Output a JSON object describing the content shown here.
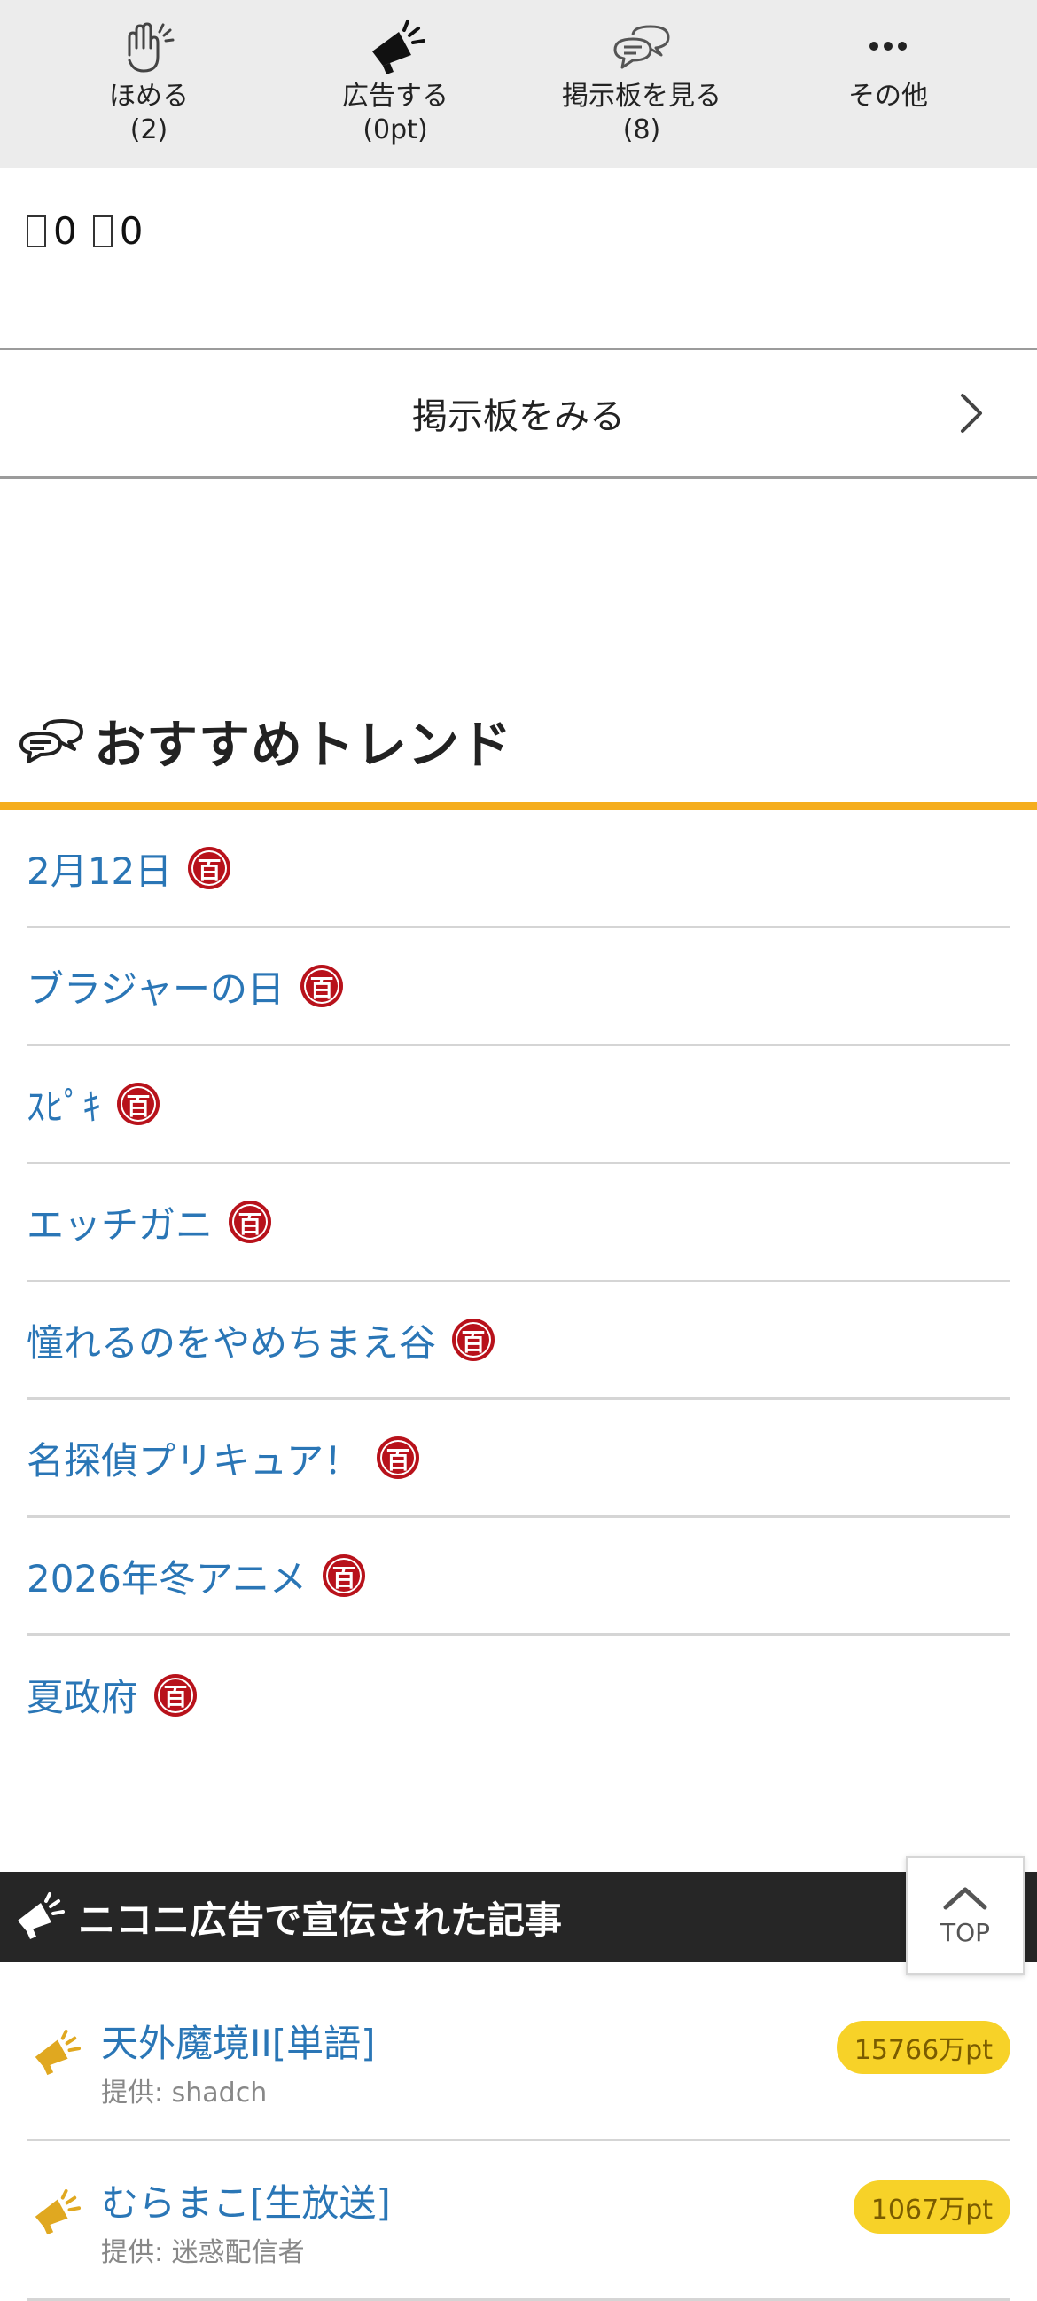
{
  "action_bar": {
    "items": [
      {
        "label": "ほめる",
        "count": "(2)",
        "icon": "clapping-hands-icon"
      },
      {
        "label": "広告する",
        "count": "(0pt)",
        "icon": "megaphone-icon"
      },
      {
        "label": "掲示板を見る",
        "count": "(8)",
        "icon": "speech-bubbles-icon"
      },
      {
        "label": "その他",
        "count": "",
        "icon": "more-dots-icon"
      }
    ]
  },
  "reactions": {
    "first_value": "0",
    "second_value": "0"
  },
  "board_link": {
    "label": "掲示板をみる",
    "icon": "chevron-right-icon"
  },
  "trends": {
    "title": "おすすめトレンド",
    "icon": "speech-bubbles-icon",
    "badge_text": "百",
    "items": [
      {
        "label": "2月12日"
      },
      {
        "label": "ブラジャーの日"
      },
      {
        "label": "ｽﾋﾟｷ"
      },
      {
        "label": "エッチガニ"
      },
      {
        "label": "憧れるのをやめちまえ谷"
      },
      {
        "label": "名探偵プリキュア！"
      },
      {
        "label": "2026年冬アニメ"
      },
      {
        "label": "夏政府"
      }
    ]
  },
  "ads": {
    "title": "ニコニ広告で宣伝された記事",
    "icon": "megaphone-icon",
    "items": [
      {
        "name": "天外魔境II[単語]",
        "provider": "提供: shadch",
        "points": "15766万pt"
      },
      {
        "name": "むらまこ[生放送]",
        "provider": "提供: 迷惑配信者",
        "points": "1067万pt"
      }
    ]
  },
  "top_button": {
    "label": "TOP",
    "icon": "chevron-up-icon"
  },
  "colors": {
    "link": "#2a76b6",
    "accent_rule": "#f5ad1d",
    "badge": "#b8121b",
    "points_pill": "#f7d228",
    "ad_header": "#262626"
  }
}
